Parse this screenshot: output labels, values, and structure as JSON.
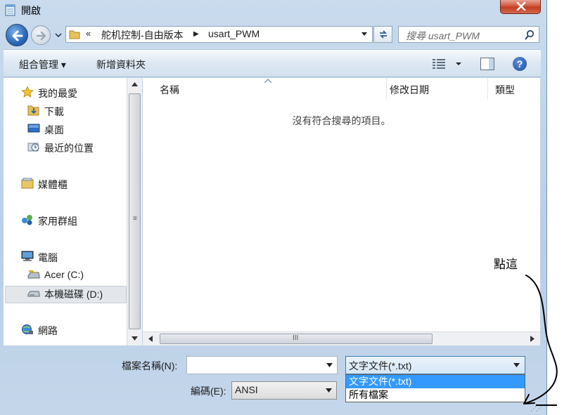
{
  "window": {
    "title": "開啟",
    "close_label": "✕"
  },
  "address": {
    "chevrons": "«",
    "crumbs": [
      "舵机控制-自由版本",
      "usart_PWM"
    ],
    "separator": "▶"
  },
  "search": {
    "placeholder": "搜尋 usart_PWM"
  },
  "toolbar": {
    "organize_label": "組合管理 ▾",
    "new_folder_label": "新增資料夾",
    "help_label": "?"
  },
  "nav": {
    "items": [
      {
        "label": "我的最愛",
        "icon": "star-icon"
      },
      {
        "label": "下載",
        "icon": "downloads-folder-icon"
      },
      {
        "label": "桌面",
        "icon": "desktop-icon"
      },
      {
        "label": "最近的位置",
        "icon": "recent-places-icon"
      },
      {
        "label": "媒體櫃",
        "icon": "libraries-icon"
      },
      {
        "label": "家用群組",
        "icon": "homegroup-icon"
      },
      {
        "label": "電腦",
        "icon": "computer-icon"
      },
      {
        "label": "Acer (C:)",
        "icon": "drive-icon"
      },
      {
        "label": "本機磁碟 (D:)",
        "icon": "drive-icon"
      },
      {
        "label": "網路",
        "icon": "network-icon"
      }
    ],
    "selected_index": 8,
    "scroll_grip": "≡"
  },
  "file_list": {
    "columns": [
      "名稱",
      "修改日期",
      "類型"
    ],
    "empty_message": "沒有符合搜尋的項目。",
    "hscroll_grip": "III"
  },
  "footer": {
    "filename_label": "檔案名稱(N):",
    "filename_value": "",
    "filetype_value": "文字文件(*.txt)",
    "filetype_options": [
      "文字文件(*.txt)",
      "所有檔案"
    ],
    "encoding_label": "編碼(E):",
    "encoding_value": "ANSI"
  },
  "annotation": {
    "text": "點這"
  },
  "colors": {
    "selection": "#3399ff",
    "frame": "#c4d6ea",
    "close_button": "#c23b22"
  }
}
